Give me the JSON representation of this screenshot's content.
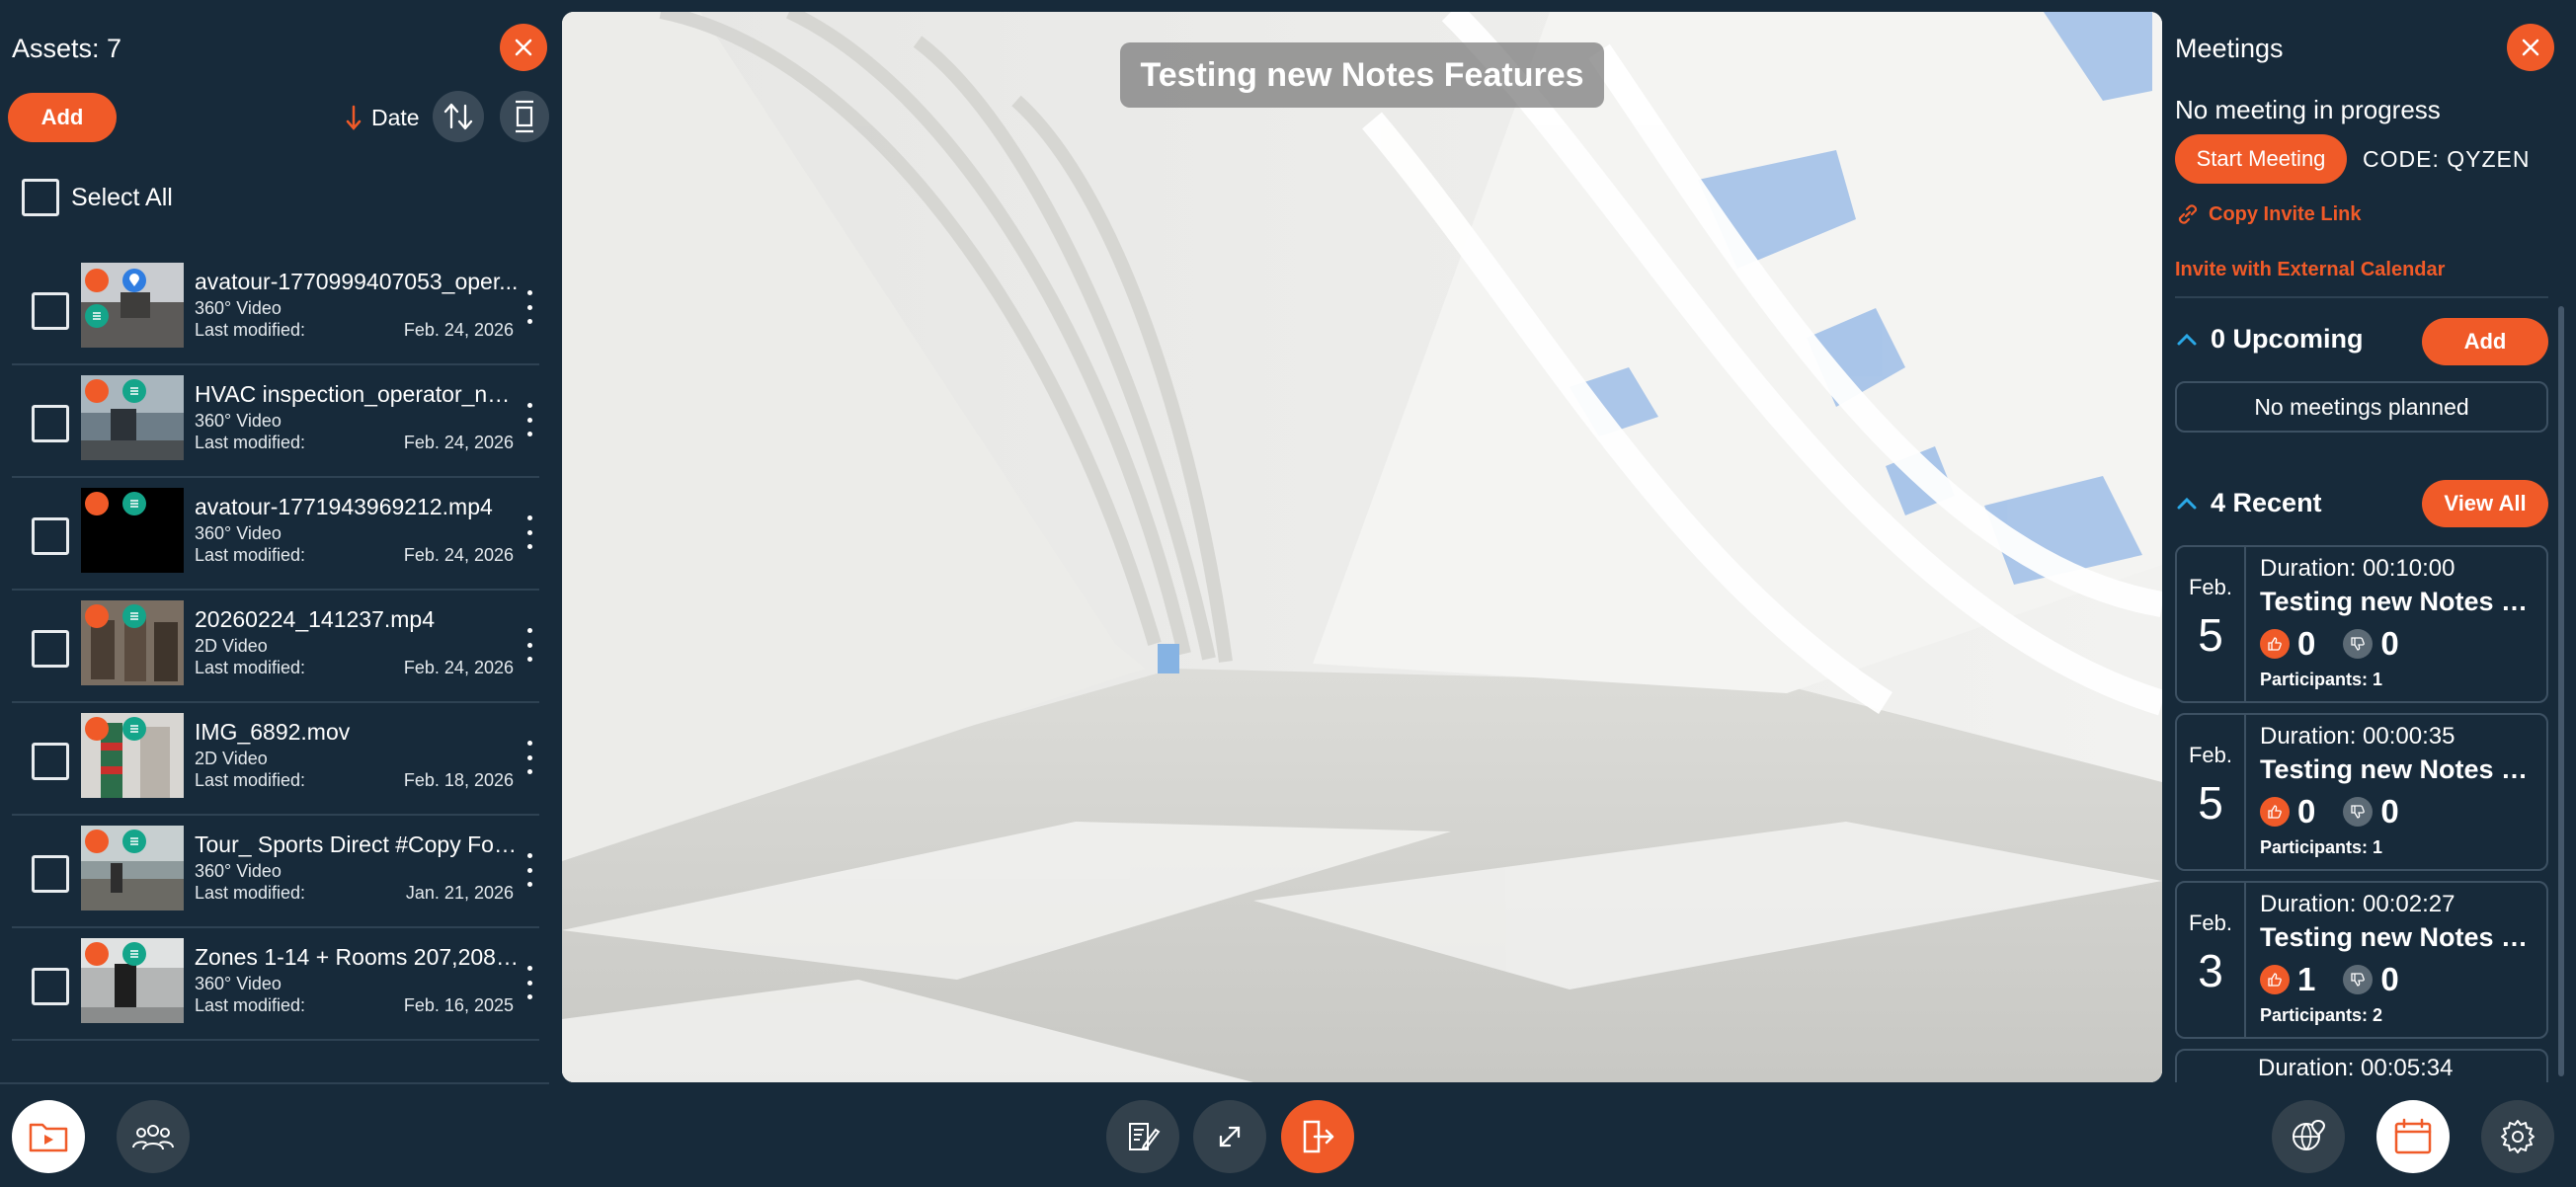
{
  "assets_panel": {
    "title": "Assets: 7",
    "add_label": "Add",
    "sort_label": "Date",
    "select_all_label": "Select All",
    "items": [
      {
        "name": "avatour-1770999407053_oper...",
        "type": "360° Video",
        "modified_label": "Last modified:",
        "date": "Feb. 24, 2026"
      },
      {
        "name": "HVAC inspection_operator_not...",
        "type": "360° Video",
        "modified_label": "Last modified:",
        "date": "Feb. 24, 2026"
      },
      {
        "name": "avatour-1771943969212.mp4",
        "type": "360° Video",
        "modified_label": "Last modified:",
        "date": "Feb. 24, 2026"
      },
      {
        "name": "20260224_141237.mp4",
        "type": "2D Video",
        "modified_label": "Last modified:",
        "date": "Feb. 24, 2026"
      },
      {
        "name": "IMG_6892.mov",
        "type": "2D Video",
        "modified_label": "Last modified:",
        "date": "Feb. 18, 2026"
      },
      {
        "name": "Tour_ Sports Direct #Copy For ...",
        "type": "360° Video",
        "modified_label": "Last modified:",
        "date": "Jan. 21, 2026"
      },
      {
        "name": "Zones 1-14 + Rooms 207,208, ...",
        "type": "360° Video",
        "modified_label": "Last modified:",
        "date": "Feb. 16, 2025"
      }
    ]
  },
  "viewer": {
    "title": "Testing new Notes Features"
  },
  "meetings_panel": {
    "title": "Meetings",
    "status": "No meeting in progress",
    "start_label": "Start Meeting",
    "code": "CODE: QYZEN",
    "copy_link_label": "Copy Invite Link",
    "calendar_label": "Invite with External Calendar",
    "upcoming_label": "0 Upcoming",
    "upcoming_add_label": "Add",
    "no_meetings_label": "No meetings planned",
    "recent_label": "4 Recent",
    "view_all_label": "View All",
    "recent": [
      {
        "month": "Feb.",
        "day": "5",
        "duration": "Duration: 00:10:00",
        "title": "Testing new Notes Fe...",
        "up": "0",
        "down": "0",
        "participants_label": "Participants:",
        "participants": "1"
      },
      {
        "month": "Feb.",
        "day": "5",
        "duration": "Duration: 00:00:35",
        "title": "Testing new Notes Fe...",
        "up": "0",
        "down": "0",
        "participants_label": "Participants:",
        "participants": "1"
      },
      {
        "month": "Feb.",
        "day": "3",
        "duration": "Duration: 00:02:27",
        "title": "Testing new Notes Fe...",
        "up": "1",
        "down": "0",
        "participants_label": "Participants:",
        "participants": "2"
      },
      {
        "duration": "Duration: 00:05:34"
      }
    ]
  },
  "colors": {
    "background": "#172a3a",
    "accent": "#f05a28",
    "teal_badge": "#14a58a",
    "blue_badge": "#2f7de1"
  }
}
